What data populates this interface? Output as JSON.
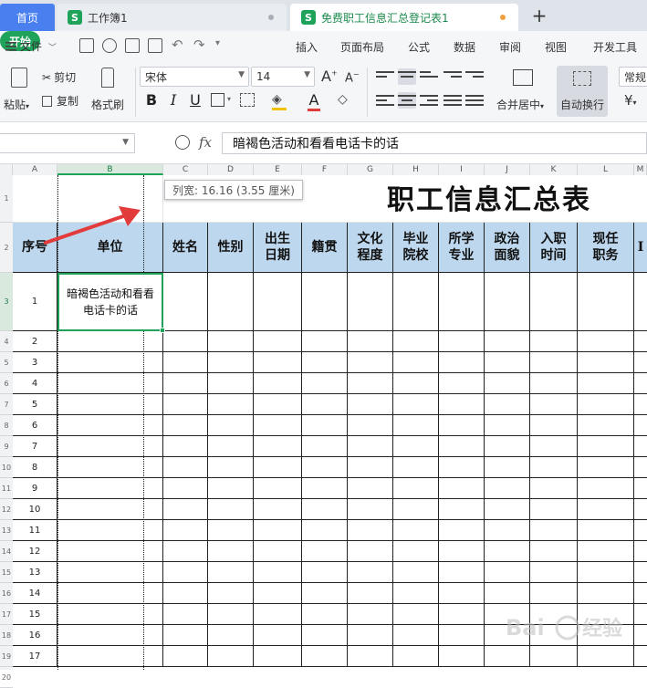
{
  "tabs": {
    "home": "首页",
    "workbook1": "工作簿1",
    "workbook2": "免费职工信息汇总登记表1",
    "add": "+"
  },
  "menu": {
    "file": "文件",
    "items": [
      "开始",
      "插入",
      "页面布局",
      "公式",
      "数据",
      "审阅",
      "视图",
      "开发工具"
    ]
  },
  "ribbon": {
    "paste": "粘贴",
    "cut": "剪切",
    "copy": "复制",
    "format_painter": "格式刷",
    "font_name": "宋体",
    "font_size": "14",
    "grow_font": "A",
    "shrink_font": "A",
    "bold": "B",
    "italic": "I",
    "underline": "U",
    "font_color": "A",
    "merge_center": "合并居中",
    "wrap_text": "自动换行",
    "number_format": "常规",
    "currency": "¥"
  },
  "formula_bar": {
    "name_box": "",
    "fx": "fx",
    "content": "暗褐色活动和看看电话卡的话"
  },
  "columns": [
    "A",
    "B",
    "C",
    "D",
    "E",
    "F",
    "G",
    "H",
    "I",
    "J",
    "K",
    "L",
    "M"
  ],
  "row_numbers": [
    "1",
    "2",
    "3",
    "4",
    "5",
    "6",
    "7",
    "8",
    "9",
    "10",
    "11",
    "12",
    "13",
    "14",
    "15",
    "16",
    "17",
    "18",
    "19",
    "20"
  ],
  "sheet": {
    "title": "职工信息汇总表",
    "headers": [
      "序号",
      "单位",
      "姓名",
      "性别",
      "出生\n日期",
      "籍贯",
      "文化\n程度",
      "毕业\n院校",
      "所学\n专业",
      "政治\n面貌",
      "入职\n时间",
      "现任\n职务",
      "I"
    ],
    "first_row_value": "暗褐色活动和看看电话卡的话",
    "serials": [
      "1",
      "2",
      "3",
      "4",
      "5",
      "6",
      "7",
      "8",
      "9",
      "10",
      "11",
      "12",
      "13",
      "14",
      "15",
      "16",
      "17"
    ]
  },
  "tooltip": {
    "text": "列宽: 16.16 (3.55 厘米)"
  },
  "colors": {
    "accent_green": "#1fa35a",
    "header_blue": "#bdd7ee",
    "tab_blue": "#4a7ff0",
    "arrow_red": "#e23b3b"
  }
}
